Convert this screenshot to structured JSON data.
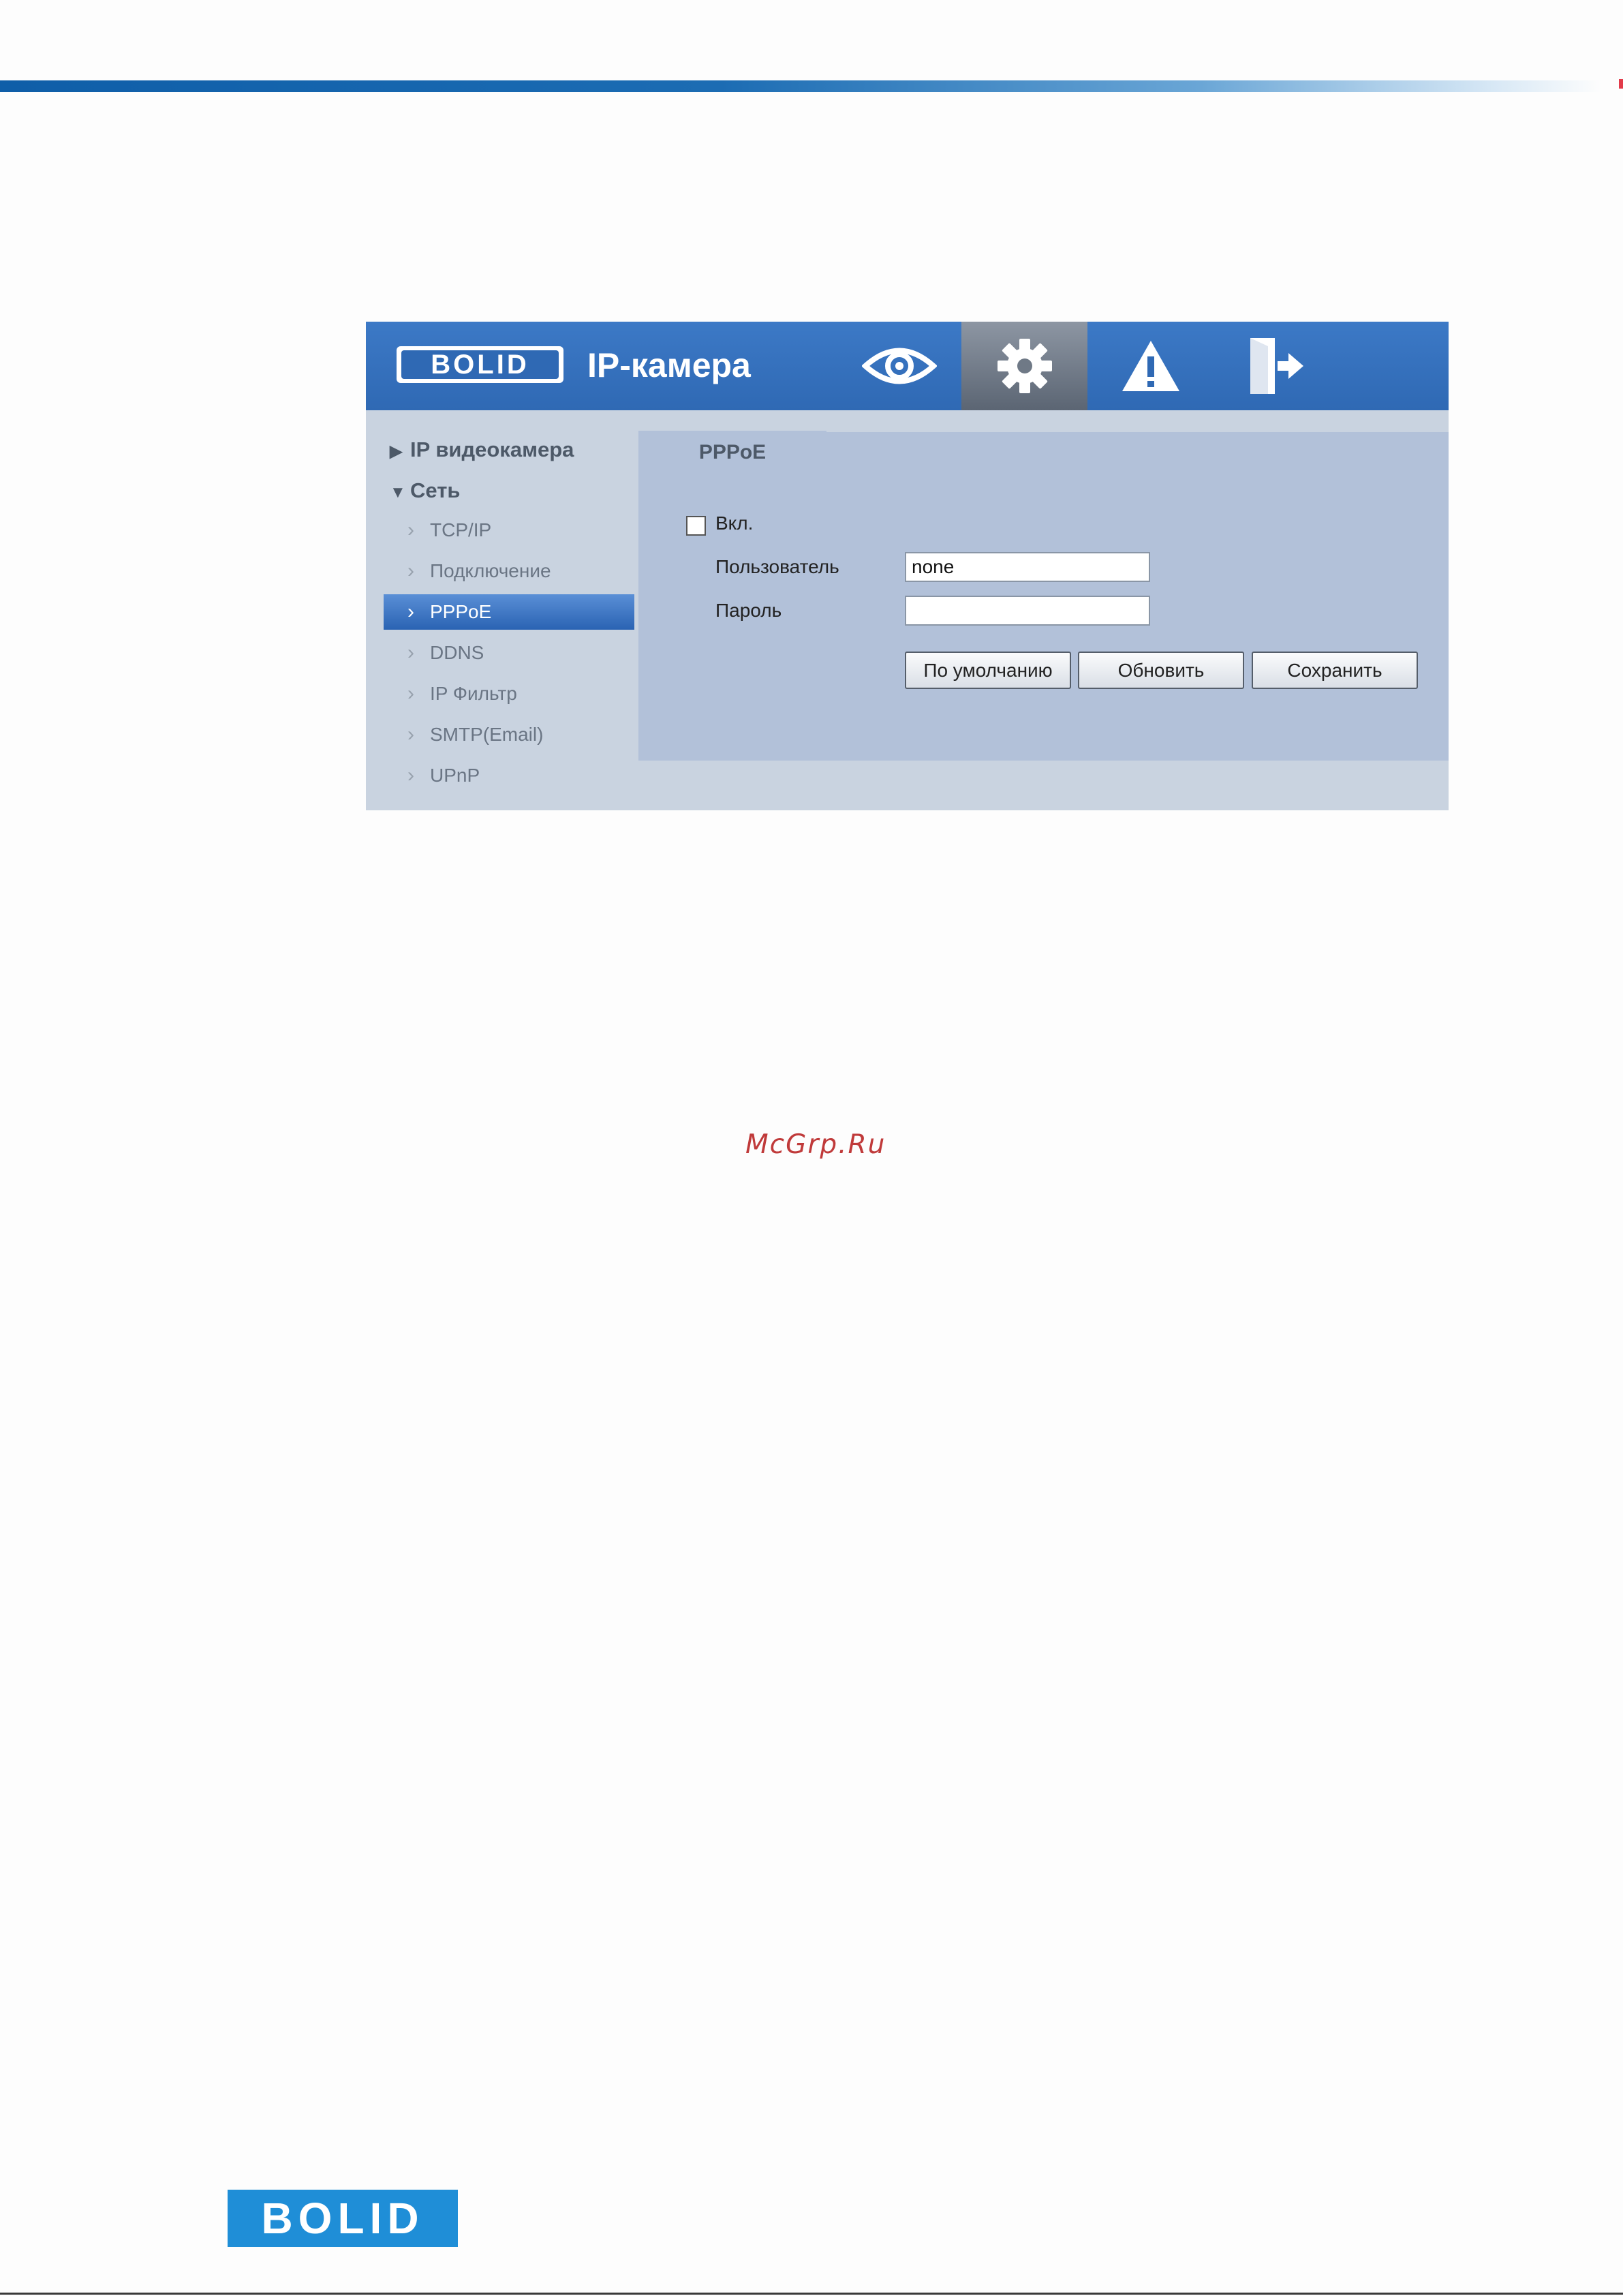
{
  "header": {
    "logo_text": "BOLID",
    "app_title": "IP-камера",
    "nav": [
      "eye-icon",
      "gear-icon",
      "warning-icon",
      "exit-icon"
    ],
    "active_nav": "gear-icon"
  },
  "sidebar": {
    "groups": [
      {
        "label": "IP видеокамера",
        "expanded": false
      },
      {
        "label": "Сеть",
        "expanded": true
      }
    ],
    "items": [
      "TCP/IP",
      "Подключение",
      "PPPoE",
      "DDNS",
      "IP Фильтр",
      "SMTP(Email)",
      "UPnP"
    ],
    "active_item": "PPPoE"
  },
  "tab": {
    "label": "PPPoE"
  },
  "form": {
    "enable_label": "Вкл.",
    "enable_checked": false,
    "user_label": "Пользователь",
    "user_value": "none",
    "password_label": "Пароль",
    "password_value": ""
  },
  "buttons": {
    "default": "По умолчанию",
    "refresh": "Обновить",
    "save": "Сохранить"
  },
  "watermark": "McGrp.Ru",
  "footer": {
    "logo_text": "BOLID"
  },
  "colors": {
    "header_blue": "#2f69b4",
    "active_item_blue": "#2a63b3",
    "content_bg": "#b2c1d9",
    "panel_bg": "#c9d3e0",
    "watermark_red": "#c03a3a",
    "footer_logo_blue": "#1f8ed7"
  }
}
